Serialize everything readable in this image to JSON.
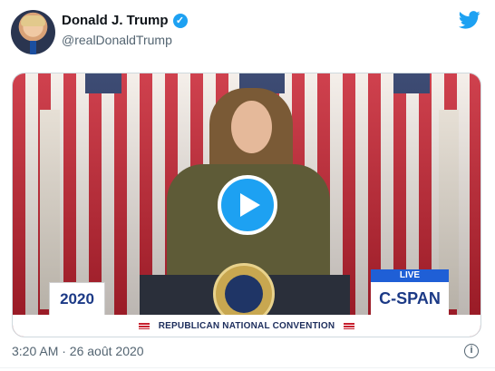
{
  "tweet": {
    "display_name": "Donald J. Trump",
    "handle": "@realDonaldTrump",
    "verified_glyph": "✓",
    "timestamp": "3:20 AM · 26 août 2020",
    "info_glyph": "i"
  },
  "media": {
    "logo_2020": "2020",
    "broadcaster_live": "LIVE",
    "broadcaster_name": "C-SPAN",
    "banner_text": "REPUBLICAN NATIONAL CONVENTION"
  },
  "icons": {
    "avatar": "profile-avatar",
    "verified": "verified-badge-icon",
    "twitter": "twitter-bird-icon",
    "play": "play-icon",
    "info": "info-icon"
  },
  "colors": {
    "twitter_blue": "#1da1f2",
    "secondary_text": "#536471",
    "primary_text": "#0f1419"
  }
}
